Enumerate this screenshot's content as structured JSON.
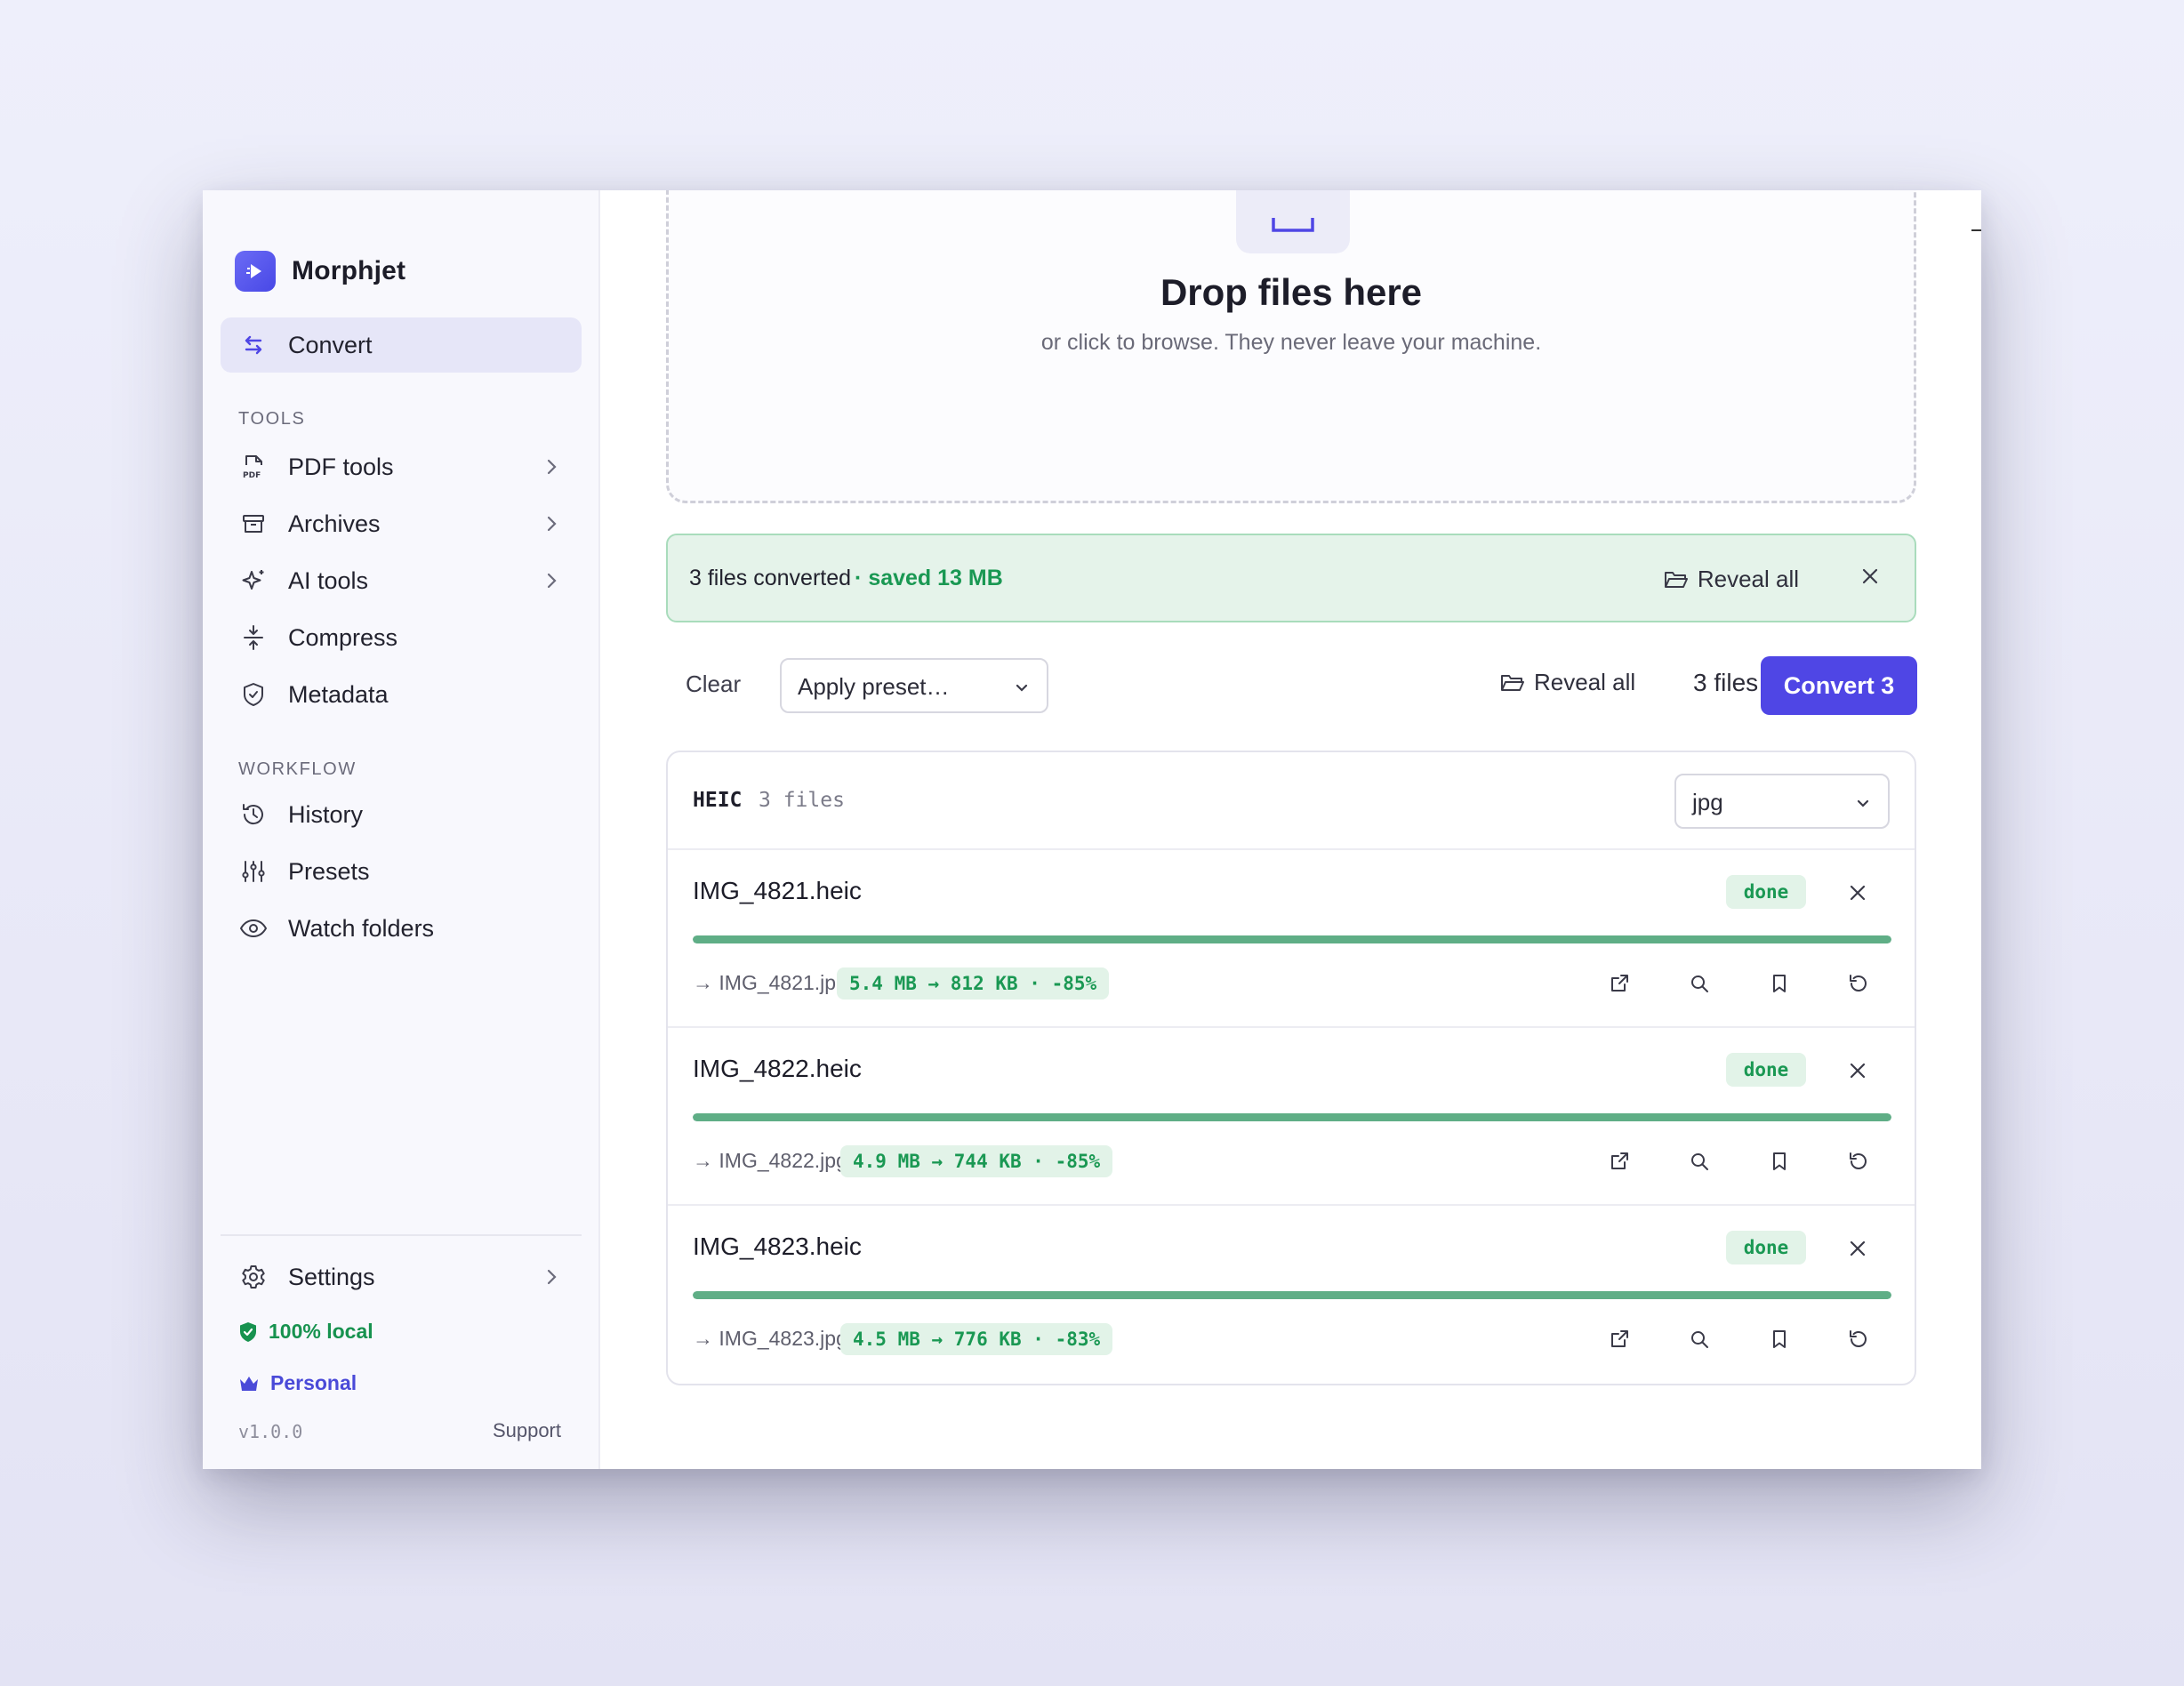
{
  "app": {
    "name": "Morphjet"
  },
  "sidebar": {
    "primary": {
      "label": "Convert"
    },
    "tools_heading": "TOOLS",
    "tools": [
      {
        "label": "PDF tools"
      },
      {
        "label": "Archives"
      },
      {
        "label": "AI tools"
      },
      {
        "label": "Compress"
      },
      {
        "label": "Metadata"
      }
    ],
    "workflow_heading": "WORKFLOW",
    "workflow": [
      {
        "label": "History"
      },
      {
        "label": "Presets"
      },
      {
        "label": "Watch folders"
      }
    ],
    "settings_label": "Settings",
    "local_badge": "100% local",
    "plan_label": "Personal",
    "version": "v1.0.0",
    "support_label": "Support"
  },
  "dropzone": {
    "title": "Drop files here",
    "subtitle": "or click to browse. They never leave your machine."
  },
  "banner": {
    "message": "3 files converted",
    "saved": "· saved 13 MB",
    "reveal_label": "Reveal all"
  },
  "toolbar": {
    "clear_label": "Clear",
    "preset_placeholder": "Apply preset…",
    "reveal_label": "Reveal all",
    "file_count": "3 files",
    "convert_label": "Convert 3"
  },
  "group": {
    "format": "HEIC",
    "count": "3 files",
    "target_format": "jpg"
  },
  "files": [
    {
      "name": "IMG_4821.heic",
      "status": "done",
      "progress": 1.0,
      "output": "→ IMG_4821.jpg",
      "stats": "5.4 MB → 812 KB · -85%"
    },
    {
      "name": "IMG_4822.heic",
      "status": "done",
      "progress": 1.0,
      "output": "→ IMG_4822.jpg",
      "stats": "4.9 MB → 744 KB · -85%"
    },
    {
      "name": "IMG_4823.heic",
      "status": "done",
      "progress": 1.0,
      "output": "→ IMG_4823.jpg",
      "stats": "4.5 MB → 776 KB · -83%"
    }
  ],
  "colors": {
    "accent": "#4f46e5",
    "success": "#1a9853",
    "progress": "#5fae86",
    "banner_bg": "#e5f3ea"
  }
}
